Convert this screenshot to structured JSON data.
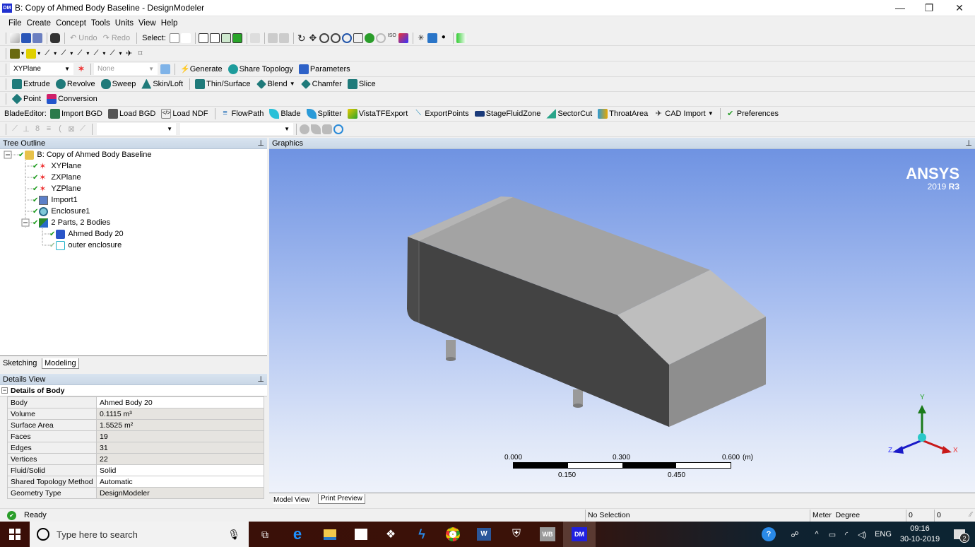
{
  "window": {
    "title": "B: Copy of Ahmed Body Baseline - DesignModeler",
    "logo": "DM",
    "controls": {
      "minimize": "—",
      "maximize": "❐",
      "close": "✕"
    }
  },
  "menu": [
    "File",
    "Create",
    "Concept",
    "Tools",
    "Units",
    "View",
    "Help"
  ],
  "toolbar1": {
    "undo": "Undo",
    "redo": "Redo",
    "select_label": "Select:"
  },
  "toolbar3": {
    "plane_combo": "XYPlane",
    "sketch_combo": "None",
    "generate": "Generate",
    "share_topology": "Share Topology",
    "parameters": "Parameters"
  },
  "toolbar4": {
    "extrude": "Extrude",
    "revolve": "Revolve",
    "sweep": "Sweep",
    "skin_loft": "Skin/Loft",
    "thin_surface": "Thin/Surface",
    "blend": "Blend",
    "chamfer": "Chamfer",
    "slice": "Slice"
  },
  "toolbar5": {
    "point": "Point",
    "conversion": "Conversion"
  },
  "toolbar6": {
    "label": "BladeEditor:",
    "items": [
      "Import BGD",
      "Load BGD",
      "Load NDF",
      "FlowPath",
      "Blade",
      "Splitter",
      "VistaTFExport",
      "ExportPoints",
      "StageFluidZone",
      "SectorCut",
      "ThroatArea",
      "CAD Import",
      "Preferences"
    ]
  },
  "tree": {
    "header": "Tree Outline",
    "root": "B: Copy of Ahmed Body Baseline",
    "items": [
      "XYPlane",
      "ZXPlane",
      "YZPlane",
      "Import1",
      "Enclosure1",
      "2 Parts, 2 Bodies"
    ],
    "bodies": [
      "Ahmed Body 20",
      "outer enclosure"
    ]
  },
  "tabs": {
    "sketching": "Sketching",
    "modeling": "Modeling"
  },
  "details": {
    "header": "Details View",
    "section": "Details of Body",
    "rows": [
      {
        "k": "Body",
        "v": "Ahmed Body 20"
      },
      {
        "k": "Volume",
        "v": "0.1115 m³"
      },
      {
        "k": "Surface Area",
        "v": "1.5525 m²"
      },
      {
        "k": "Faces",
        "v": "19"
      },
      {
        "k": "Edges",
        "v": "31"
      },
      {
        "k": "Vertices",
        "v": "22"
      },
      {
        "k": "Fluid/Solid",
        "v": "Solid"
      },
      {
        "k": "Shared Topology Method",
        "v": "Automatic"
      },
      {
        "k": "Geometry Type",
        "v": "DesignModeler"
      }
    ]
  },
  "graphics": {
    "header": "Graphics",
    "brand": "ANSYS",
    "version_prefix": "2019",
    "version_suffix": "R3",
    "scale": {
      "top": [
        "0.000",
        "0.300",
        "0.600"
      ],
      "bottom": [
        "0.150",
        "0.450"
      ],
      "unit": "(m)"
    },
    "axes": {
      "x": "X",
      "y": "Y",
      "z": "Z"
    },
    "view_tabs": [
      "Model View",
      "Print Preview"
    ]
  },
  "status": {
    "ready": "Ready",
    "selection": "No Selection",
    "units": "Meter  Degree",
    "v1": "0",
    "v2": "0"
  },
  "taskbar": {
    "search_placeholder": "Type here to search",
    "lang": "ENG",
    "time": "09:16",
    "date": "30-10-2019",
    "notifications": "2",
    "wb": "WB",
    "dm": "DM"
  }
}
